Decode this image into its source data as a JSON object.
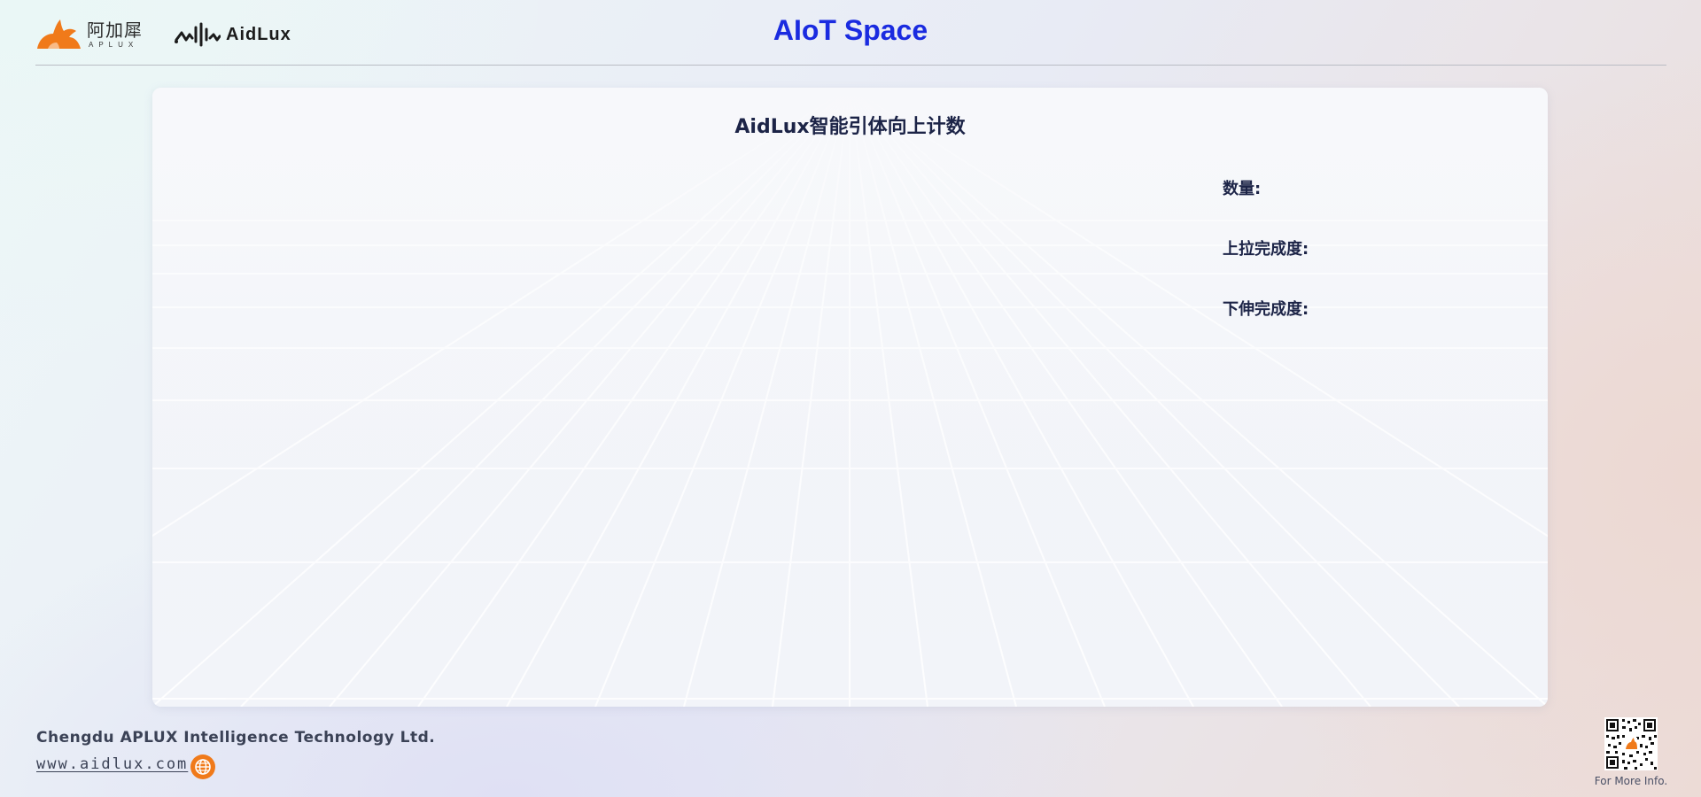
{
  "header": {
    "brand_cn": "阿加犀",
    "brand_en": "APLUX",
    "brand2": "AidLux",
    "title": "AIoT Space"
  },
  "panel": {
    "title": "AidLux智能引体向上计数",
    "stats": [
      {
        "label": "数量:",
        "value": ""
      },
      {
        "label": "上拉完成度:",
        "value": ""
      },
      {
        "label": "下伸完成度:",
        "value": ""
      }
    ]
  },
  "footer": {
    "company": "Chengdu APLUX Intelligence Technology Ltd.",
    "url": "www.aidlux.com",
    "qr_caption": "For More Info."
  },
  "icons": {
    "aplux_logo": "fox-logo-icon",
    "aidlux_logo": "waveform-logo-icon",
    "globe": "globe-icon",
    "qr": "qr-code-icon"
  },
  "colors": {
    "title_blue": "#1a2be0",
    "text_dark": "#1c2447",
    "brand_orange": "#f07a1a"
  }
}
